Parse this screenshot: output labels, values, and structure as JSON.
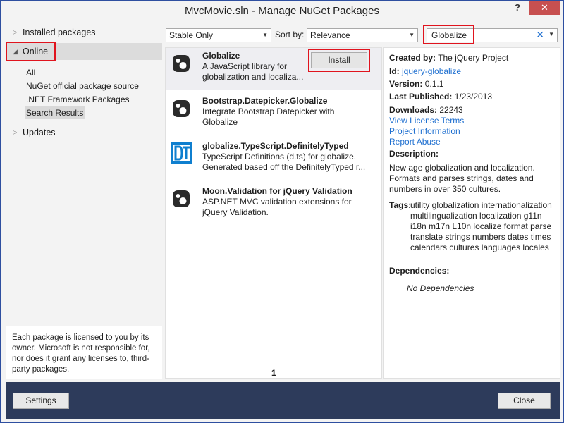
{
  "window": {
    "title": "MvcMovie.sln - Manage NuGet Packages",
    "help": "?",
    "close": "✕"
  },
  "sidebar": {
    "installed": "Installed packages",
    "online": "Online",
    "children": [
      "All",
      "NuGet official package source",
      ".NET Framework Packages",
      "Search Results"
    ],
    "updates": "Updates",
    "license": "Each package is licensed to you by its owner. Microsoft is not responsible for, nor does it grant any licenses to, third-party packages."
  },
  "toolbar": {
    "filter": "Stable Only",
    "sort_label": "Sort by:",
    "sort": "Relevance",
    "search_value": "Globalize",
    "clear": "✕"
  },
  "packages": [
    {
      "name": "Globalize",
      "desc": "A JavaScript library for globalization and localiza...",
      "icon": "nuget-icon"
    },
    {
      "name": "Bootstrap.Datepicker.Globalize",
      "desc": "Integrate Bootstrap Datepicker with Globalize",
      "icon": "nuget-icon"
    },
    {
      "name": "globalize.TypeScript.DefinitelyTyped",
      "desc": "TypeScript Definitions (d.ts) for globalize. Generated based off the DefinitelyTyped r...",
      "icon": "definitelytyped-icon"
    },
    {
      "name": "Moon.Validation for jQuery Validation",
      "desc": "ASP.NET MVC validation extensions for jQuery Validation.",
      "icon": "nuget-icon"
    }
  ],
  "install_label": "Install",
  "page_number": "1",
  "details": {
    "created_by_label": "Created by:",
    "created_by": "The jQuery Project",
    "id_label": "Id:",
    "id": "jquery-globalize",
    "version_label": "Version:",
    "version": "0.1.1",
    "published_label": "Last Published:",
    "published": "1/23/2013",
    "downloads_label": "Downloads:",
    "downloads": "22243",
    "license_link": "View License Terms",
    "project_link": "Project Information",
    "abuse_link": "Report Abuse",
    "description_label": "Description:",
    "description": "New age globalization and localization. Formats and parses strings, dates and numbers in over 350 cultures.",
    "tags_label": "Tags:",
    "tags": "utility globalization internationalization multilingualization localization g11n i18n m17n L10n localize format parse translate strings numbers dates times calendars cultures languages locales",
    "deps_label": "Dependencies:",
    "deps": "No Dependencies"
  },
  "footer": {
    "settings": "Settings",
    "close": "Close"
  },
  "colors": {
    "highlight": "#e0141e",
    "footer_bg": "#2d3b5b",
    "link": "#1e6fd0"
  }
}
